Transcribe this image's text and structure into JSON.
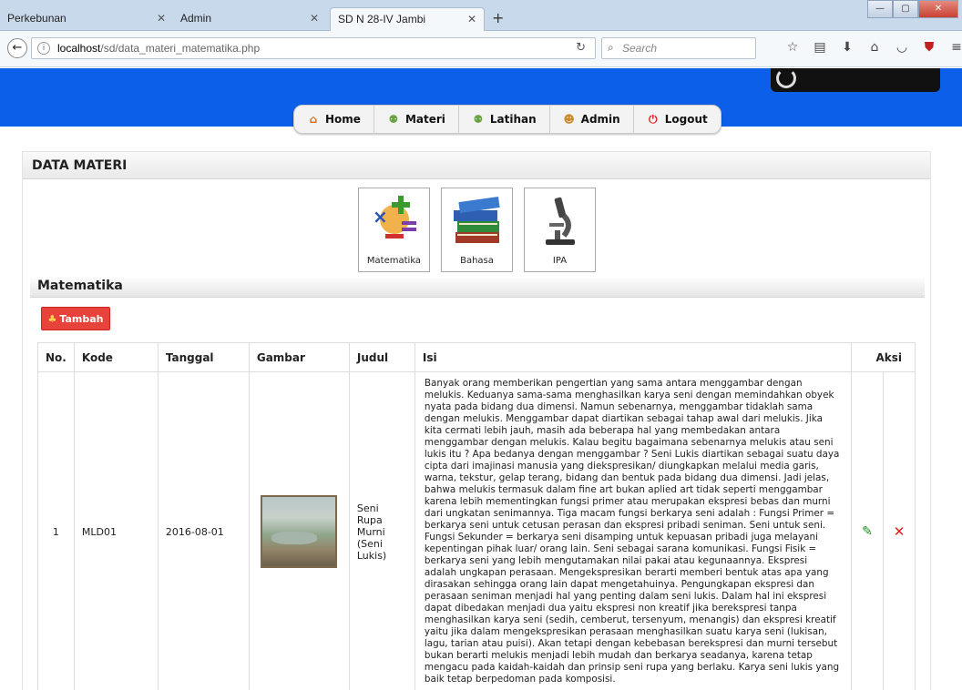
{
  "browser": {
    "tabs": [
      {
        "label": "Perkebunan"
      },
      {
        "label": "Admin"
      },
      {
        "label": "SD N 28-IV Jambi"
      }
    ],
    "url_host": "localhost",
    "url_path": "/sd/data_materi_matematika.php",
    "search_placeholder": "Search"
  },
  "menu": {
    "items": [
      {
        "label": "Home",
        "icon": "home-icon"
      },
      {
        "label": "Materi",
        "icon": "users-icon"
      },
      {
        "label": "Latihan",
        "icon": "users-icon"
      },
      {
        "label": "Admin",
        "icon": "user-icon"
      },
      {
        "label": "Logout",
        "icon": "power-icon"
      }
    ]
  },
  "panel": {
    "title": "DATA MATERI",
    "categories": [
      {
        "label": "Matematika"
      },
      {
        "label": "Bahasa"
      },
      {
        "label": "IPA"
      }
    ],
    "section_title": "Matematika",
    "add_button": "Tambah"
  },
  "table": {
    "headers": [
      "No.",
      "Kode",
      "Tanggal",
      "Gambar",
      "Judul",
      "Isi",
      "Aksi"
    ],
    "rows": [
      {
        "no": "1",
        "kode": "MLD01",
        "tanggal": "2016-08-01",
        "judul": "Seni Rupa Murni (Seni Lukis)",
        "isi": "Banyak orang memberikan pengertian yang sama antara menggambar dengan melukis. Keduanya sama-sama menghasilkan karya seni dengan memindahkan obyek nyata pada bidang dua dimensi. Namun sebenarnya, menggambar tidaklah sama dengan melukis. Menggambar dapat diartikan sebagai tahap awal dari melukis. Jika kita cermati lebih jauh, masih ada beberapa hal yang membedakan antara menggambar dengan melukis. Kalau begitu bagaimana sebenarnya melukis atau seni lukis itu ? Apa bedanya dengan menggambar ? Seni Lukis diartikan sebagai suatu daya cipta dari imajinasi manusia yang diekspresikan/ diungkapkan melalui media garis, warna, tekstur, gelap terang, bidang dan bentuk pada bidang dua dimensi. Jadi jelas, bahwa melukis termasuk dalam fine art bukan aplied art tidak seperti menggambar karena lebih mementingkan fungsi primer atau merupakan ekspresi bebas dan murni dari ungkatan senimannya. Tiga macam fungsi berkarya seni adalah : Fungsi Primer = berkarya seni untuk cetusan perasan dan ekspresi pribadi seniman. Seni untuk seni. Fungsi Sekunder = berkarya seni disamping untuk kepuasan pribadi juga melayani kepentingan pihak luar/ orang lain. Seni sebagai sarana komunikasi. Fungsi Fisik = berkarya seni yang lebih mengutamakan nilai pakai atau kegunaannya. Ekspresi adalah ungkapan perasaan. Mengekspresikan berarti memberi bentuk atas apa yang dirasakan sehingga orang lain dapat mengetahuinya. Pengungkapan ekspresi dan perasaan seniman menjadi hal yang penting dalam seni lukis. Dalam hal ini ekspresi dapat dibedakan menjadi dua yaitu ekspresi non kreatif jika berekspresi tanpa menghasilkan karya seni (sedih, cemberut, tersenyum, menangis) dan ekspresi kreatif yaitu jika dalam mengekspresikan perasaan menghasilkan suatu karya seni (lukisan, lagu, tarian atau puisi). Akan tetapi dengan kebebasan berekspresi dan murni tersebut bukan berarti melukis menjadi lebih mudah dan berkarya seadanya, karena tetap mengacu pada kaidah-kaidah dan prinsip seni rupa yang berlaku. Karya seni lukis yang baik tetap berpedoman pada komposisi."
      }
    ]
  }
}
